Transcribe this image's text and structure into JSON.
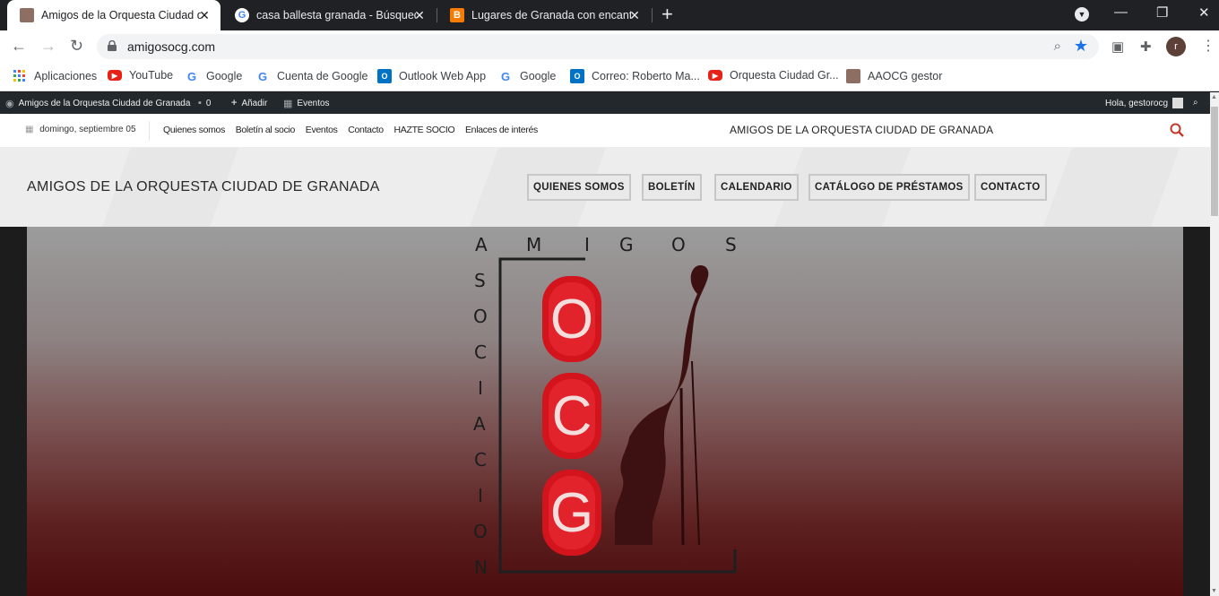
{
  "browser": {
    "tabs": [
      {
        "title": "Amigos de la Orquesta Ciudad de Granada",
        "active": true
      },
      {
        "title": "casa ballesta granada - Búsqueda de Google",
        "active": false
      },
      {
        "title": "Lugares de Granada con encanto",
        "active": false
      }
    ],
    "url": "amigosocg.com",
    "profile_initial": "r"
  },
  "bookmarks": [
    {
      "label": "Aplicaciones",
      "icon": "apps-grid-icon"
    },
    {
      "label": "YouTube",
      "icon": "youtube-icon"
    },
    {
      "label": "Google",
      "icon": "google-icon"
    },
    {
      "label": "Cuenta de Google",
      "icon": "google-icon"
    },
    {
      "label": "Outlook Web App",
      "icon": "outlook-icon"
    },
    {
      "label": "Google",
      "icon": "google-icon"
    },
    {
      "label": "Correo: Roberto Ma...",
      "icon": "outlook-icon"
    },
    {
      "label": "Orquesta Ciudad Gr...",
      "icon": "youtube-icon"
    },
    {
      "label": "AAOCG gestor",
      "icon": "site-icon"
    }
  ],
  "adminbar": {
    "site": "Amigos de la Orquesta Ciudad de Granada",
    "comments": "0",
    "add": "Añadir",
    "events": "Eventos",
    "greeting": "Hola, gestorocg"
  },
  "topbar": {
    "date": "domingo, septiembre 05",
    "menu": [
      "Quienes somos",
      "Boletín al socio",
      "Eventos",
      "Contacto",
      "HAZTE SOCIO",
      "Enlaces de interés"
    ],
    "title": "AMIGOS DE LA ORQUESTA CIUDAD DE GRANADA"
  },
  "header": {
    "site_name": "AMIGOS DE LA ORQUESTA CIUDAD DE GRANADA",
    "nav": [
      "QUIENES SOMOS",
      "BOLETÍN",
      "CALENDARIO",
      "CATÁLOGO DE PRÉSTAMOS",
      "CONTACTO"
    ]
  },
  "logo": {
    "top_word": [
      "A",
      "M",
      "I",
      "G",
      "O",
      "S"
    ],
    "side_word": [
      "S",
      "O",
      "C",
      "I",
      "A",
      "C",
      "I",
      "O",
      "N"
    ],
    "pills": [
      "O",
      "C",
      "G"
    ]
  },
  "colors": {
    "accent_red": "#d4141c",
    "admin_bar": "#23282d",
    "search_red": "#c0392b"
  }
}
